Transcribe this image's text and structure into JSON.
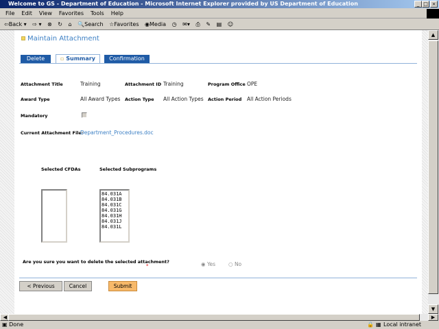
{
  "window": {
    "title": "Welcome to GS - Department of Education - Microsoft Internet Explorer provided by US Department of Education"
  },
  "menu": [
    "File",
    "Edit",
    "View",
    "Favorites",
    "Tools",
    "Help"
  ],
  "toolbar": {
    "back": "Back",
    "search": "Search",
    "favorites": "Favorites",
    "media": "Media"
  },
  "page": {
    "title": "Maintain Attachment",
    "tabs": [
      "Delete",
      "Summary",
      "Confirmation"
    ],
    "fields": {
      "attachment_title_label": "Attachment Title",
      "attachment_title": "Training",
      "attachment_id_label": "Attachment ID",
      "attachment_id": "Training",
      "program_office_label": "Program Office",
      "program_office": "OPE",
      "award_type_label": "Award Type",
      "award_type": "All Award Types",
      "action_type_label": "Action Type",
      "action_type": "All Action Types",
      "action_period_label": "Action Period",
      "action_period": "All Action Periods",
      "mandatory_label": "Mandatory",
      "current_file_label": "Current Attachment File:",
      "current_file": "Department_Procedures.doc"
    },
    "cfdas_label": "Selected CFDAs",
    "subprograms_label": "Selected Subprograms",
    "subprograms": [
      "84.031A",
      "84.031B",
      "84.031C",
      "84.031G",
      "84.031H",
      "84.031J",
      "84.031L"
    ],
    "question": "Are you sure you want to delete the selected attachment?",
    "required_mark": "*",
    "yes": "Yes",
    "no": "No",
    "buttons": {
      "previous": "< Previous",
      "cancel": "Cancel",
      "submit": "Submit"
    }
  },
  "status": {
    "text": "Done",
    "zone": "Local intranet"
  }
}
